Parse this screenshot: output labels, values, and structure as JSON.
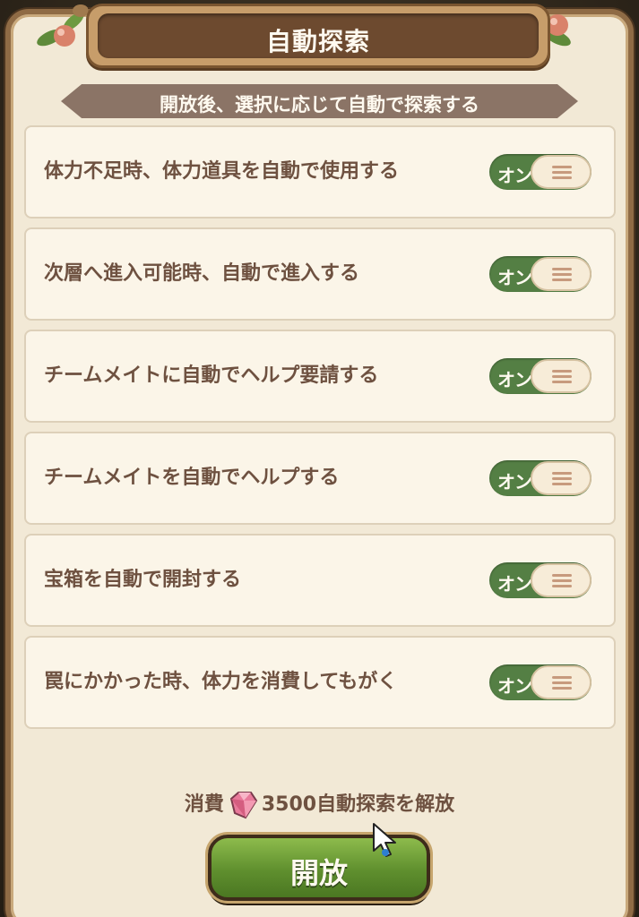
{
  "dialog": {
    "title": "自動探索",
    "subtitle": "開放後、選択に応じて自動で探索する"
  },
  "options": [
    {
      "label": "体力不足時、体力道具を自動で使用する",
      "toggle": "オン",
      "on": true
    },
    {
      "label": "次層へ進入可能時、自動で進入する",
      "toggle": "オン",
      "on": true
    },
    {
      "label": "チームメイトに自動でヘルプ要請する",
      "toggle": "オン",
      "on": true
    },
    {
      "label": "チームメイトを自動でヘルプする",
      "toggle": "オン",
      "on": true
    },
    {
      "label": "宝箱を自動で開封する",
      "toggle": "オン",
      "on": true
    },
    {
      "label": "罠にかかった時、体力を消費してもがく",
      "toggle": "オン",
      "on": true
    }
  ],
  "cost": {
    "prefix": "消費",
    "amount": "3500",
    "suffix": "自動探索を解放",
    "icon": "gem-icon"
  },
  "unlock_button": {
    "label": "開放"
  },
  "colors": {
    "toggle_on": "#547f44",
    "button_green": "#6a9a35",
    "panel_bg": "#f2e9d6",
    "text_brown": "#6e5140"
  }
}
